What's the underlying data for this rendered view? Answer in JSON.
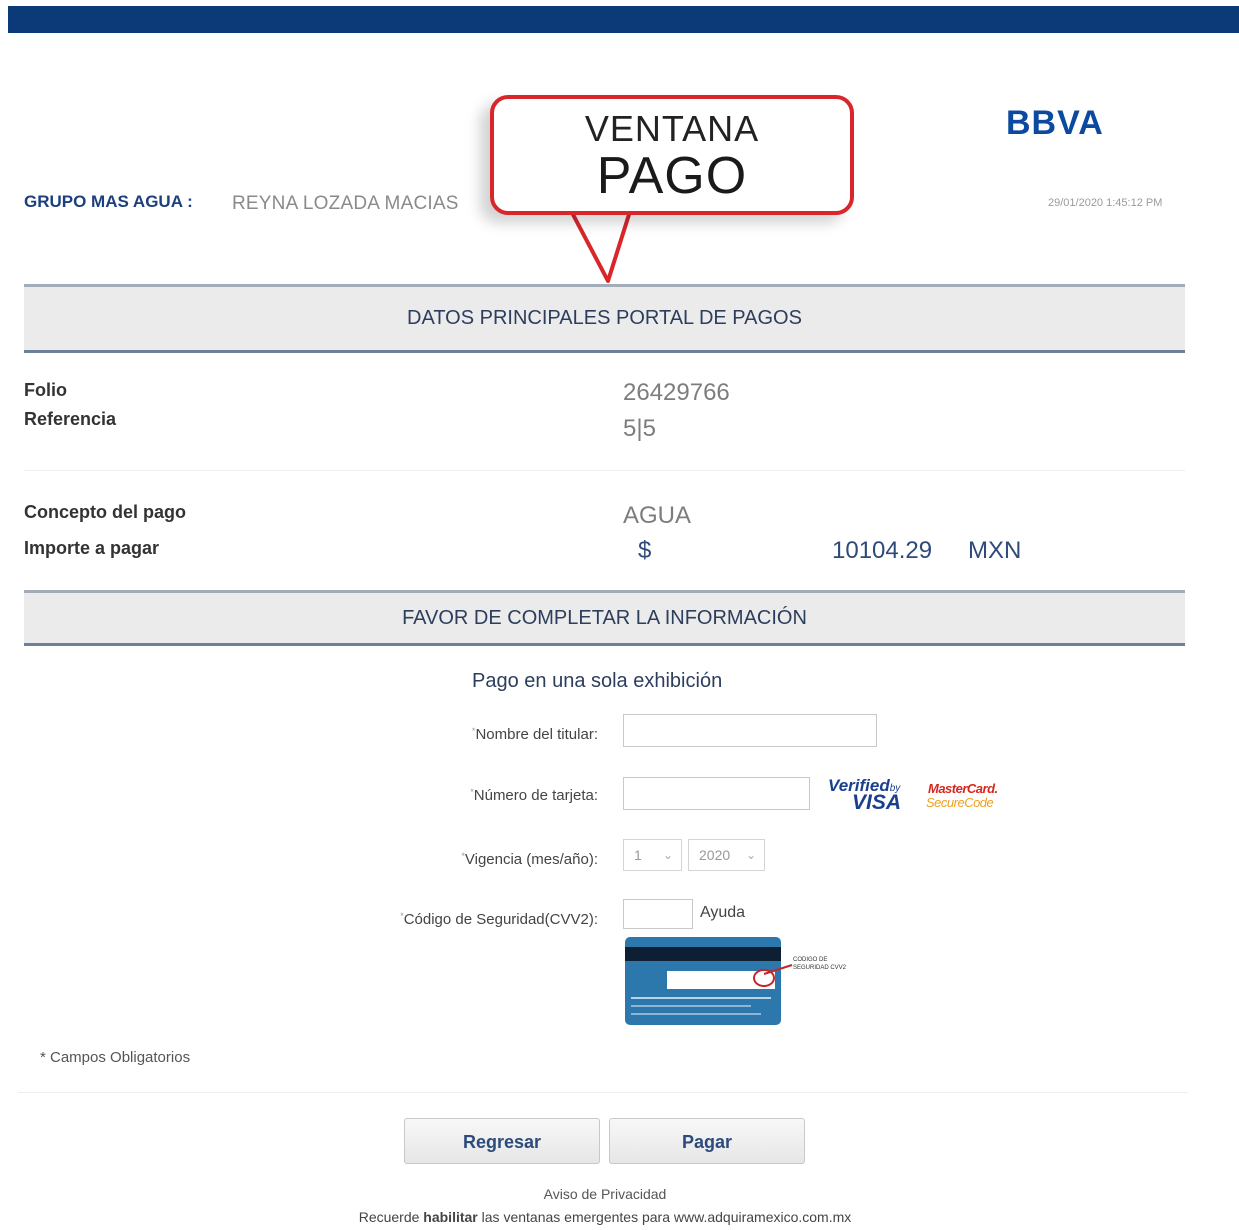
{
  "header": {
    "merchant": "GRUPO MAS AGUA :",
    "customer_name": "REYNA LOZADA MACIAS",
    "brand": "BBVA",
    "timestamp": "29/01/2020 1:45:12 PM",
    "brand_color": "#0c4aa0",
    "topbar_color": "#0c3a78"
  },
  "callout": {
    "line1": "VENTANA",
    "line2": "PAGO",
    "border_color": "#d8262a"
  },
  "section1": {
    "title": "DATOS PRINCIPALES PORTAL DE PAGOS"
  },
  "details": {
    "folio_label": "Folio",
    "folio_value": "26429766",
    "referencia_label": "Referencia",
    "referencia_value": "5|5",
    "concepto_label": "Concepto del pago",
    "concepto_value": "AGUA",
    "importe_label": "Importe a pagar",
    "currency_symbol": "$",
    "importe_value": "10104.29",
    "currency_code": "MXN"
  },
  "section2": {
    "title": "FAVOR DE COMPLETAR LA INFORMACIÓN"
  },
  "form": {
    "subtitle": "Pago en una sola exhibición",
    "required_mark": "*",
    "nombre_label": "Nombre del titular:",
    "nombre_value": "",
    "tarjeta_label": "Número de tarjeta:",
    "tarjeta_value": "",
    "vigencia_label": "Vigencia (mes/año):",
    "vigencia_mes": "1",
    "vigencia_anio": "2020",
    "cvv_label": "Código de Seguridad(CVV2):",
    "cvv_value": "",
    "ayuda_label": "Ayuda",
    "card_note": "CODIGO DE SEGURIDAD CVV2",
    "visa_line1": "Verified",
    "visa_by": "by",
    "visa_line2": "VISA",
    "mastercard_line1": "MasterCard.",
    "mastercard_line2": "SecureCode"
  },
  "footer": {
    "campos_obligatorios": "* Campos Obligatorios",
    "regresar_label": "Regresar",
    "pagar_label": "Pagar",
    "aviso_privacidad": "Aviso de Privacidad",
    "recuerde_prefix": "Recuerde ",
    "recuerde_bold": "habilitar",
    "recuerde_suffix": " las ventanas emergentes para www.adquiramexico.com.mx"
  }
}
